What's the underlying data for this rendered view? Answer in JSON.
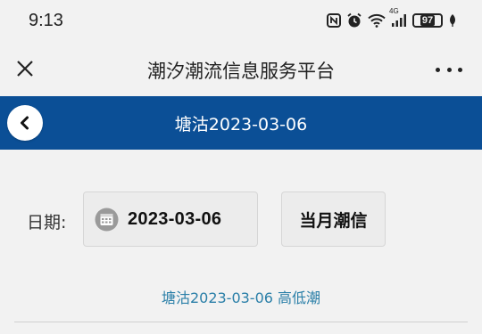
{
  "status_bar": {
    "time": "9:13",
    "battery": "97",
    "network_label": "4G",
    "icons": [
      "nfc-icon",
      "alarm-icon",
      "wifi-icon",
      "signal-icon",
      "battery-icon",
      "leaf-icon"
    ]
  },
  "header": {
    "title": "潮汐潮流信息服务平台",
    "close_icon": "close-icon",
    "more_icon": "more-icon"
  },
  "nav": {
    "title": "塘沽2023-03-06",
    "back_icon": "back-icon",
    "accent": "#0b4f96"
  },
  "form": {
    "date_label": "日期:",
    "date_value": "2023-03-06",
    "calendar_icon": "calendar-icon",
    "month_button": "当月潮信"
  },
  "section": {
    "heading": "塘沽2023-03-06 高低潮"
  }
}
